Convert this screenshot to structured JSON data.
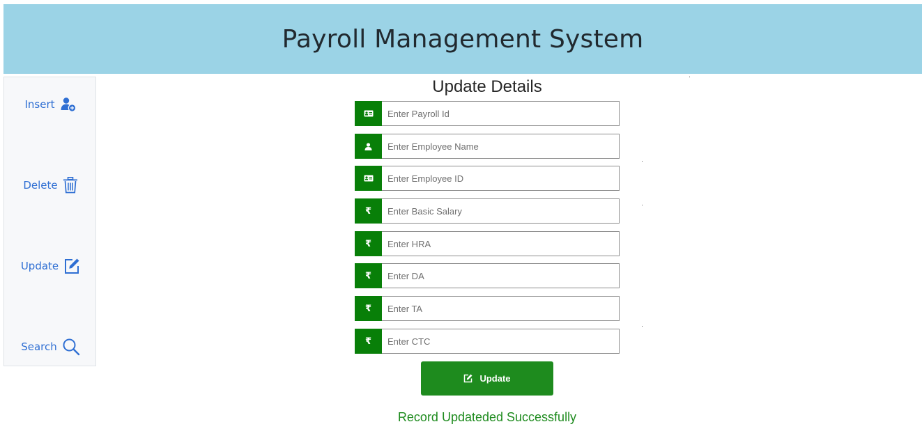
{
  "header": {
    "title": "Payroll Management System"
  },
  "sidebar": {
    "items": [
      {
        "label": "Insert",
        "icon": "user-plus-icon"
      },
      {
        "label": "Delete",
        "icon": "trash-icon"
      },
      {
        "label": "Update",
        "icon": "edit-icon"
      },
      {
        "label": "Search",
        "icon": "search-icon"
      }
    ]
  },
  "form": {
    "title": "Update Details",
    "fields": [
      {
        "placeholder": "Enter Payroll Id",
        "value": "",
        "icon": "id-card-icon",
        "glyph": ""
      },
      {
        "placeholder": "Enter Employee Name",
        "value": "",
        "icon": "user-icon",
        "glyph": ""
      },
      {
        "placeholder": "Enter Employee ID",
        "value": "",
        "icon": "id-card-icon",
        "glyph": ""
      },
      {
        "placeholder": "Enter Basic Salary",
        "value": "",
        "icon": "rupee-icon",
        "glyph": "₹"
      },
      {
        "placeholder": "Enter HRA",
        "value": "",
        "icon": "rupee-icon",
        "glyph": "₹"
      },
      {
        "placeholder": "Enter DA",
        "value": "",
        "icon": "rupee-icon",
        "glyph": "₹"
      },
      {
        "placeholder": "Enter TA",
        "value": "",
        "icon": "rupee-icon",
        "glyph": "₹"
      },
      {
        "placeholder": "Enter CTC",
        "value": "",
        "icon": "rupee-icon",
        "glyph": "₹"
      }
    ],
    "submit_label": "Update",
    "submit_icon": "edit-icon"
  },
  "status": {
    "message": "Record Updateded Successfully"
  },
  "colors": {
    "header_bg": "#9bd3e6",
    "accent_green": "#087f08",
    "button_green": "#1e8b1e",
    "link_blue": "#2f6fd3"
  }
}
